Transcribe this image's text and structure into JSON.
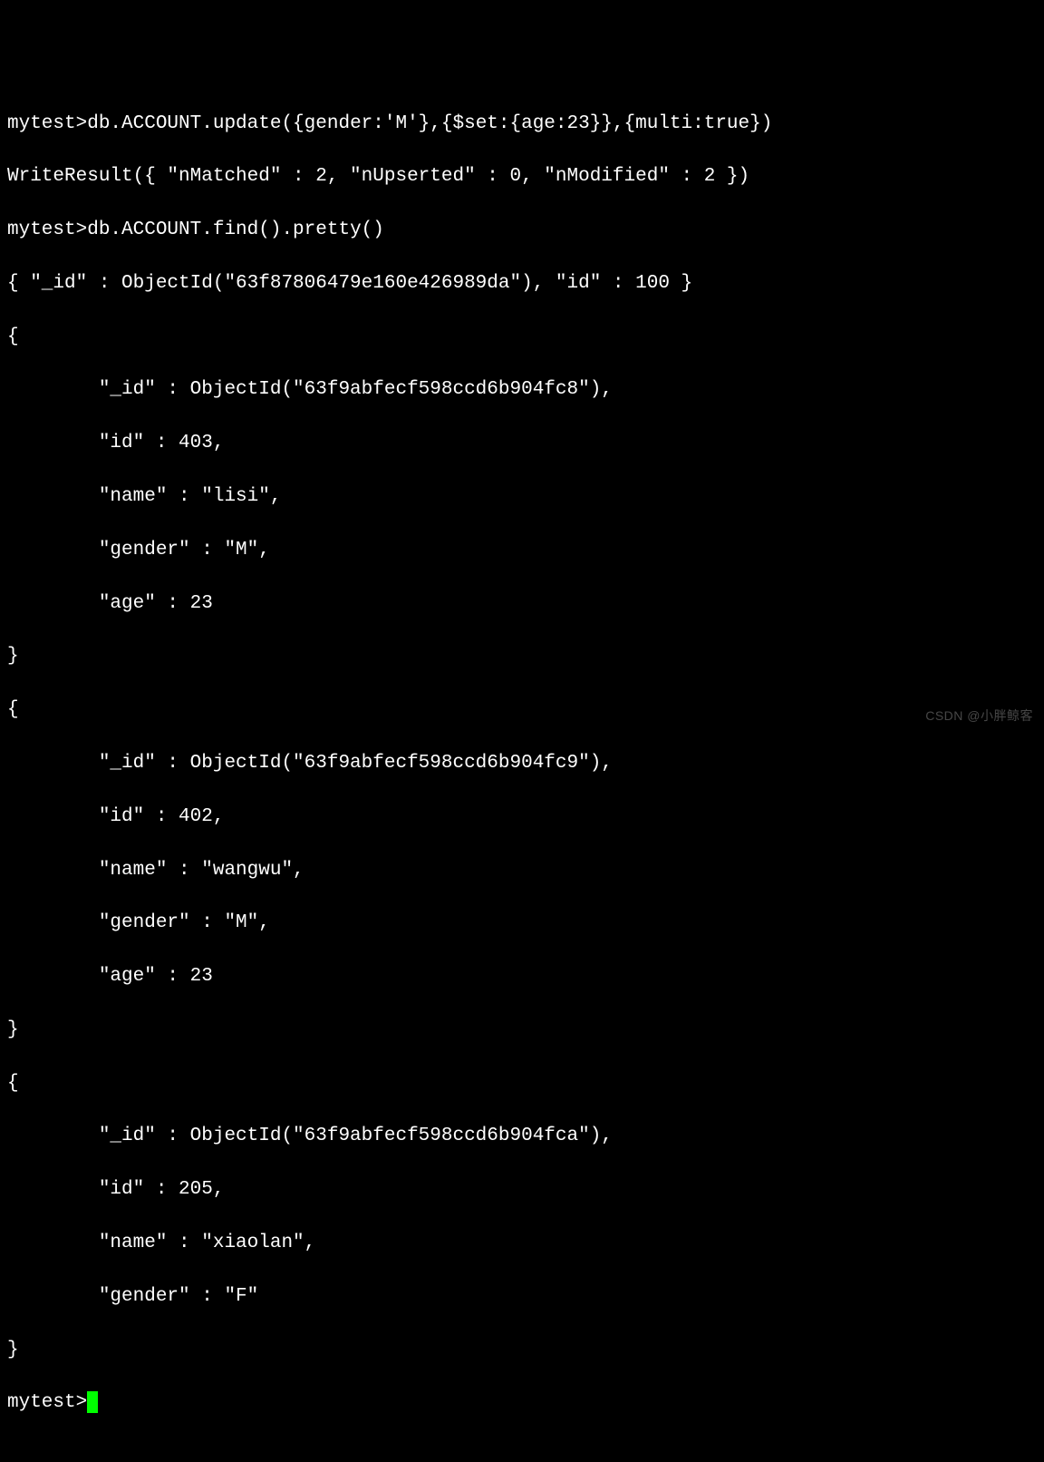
{
  "prompt": "mytest>",
  "cmd1": "db.ACCOUNT.update({gender:'M'},{$set:{age:23}},{multi:true})",
  "result1": "WriteResult({ \"nMatched\" : 2, \"nUpserted\" : 0, \"nModified\" : 2 })",
  "cmd2": "db.ACCOUNT.find().pretty()",
  "doc0": "{ \"_id\" : ObjectId(\"63f87806479e160e426989da\"), \"id\" : 100 }",
  "open": "{",
  "close": "}",
  "doc1": {
    "id_line": "        \"_id\" : ObjectId(\"63f9abfecf598ccd6b904fc8\"),",
    "num_line": "        \"id\" : 403,",
    "name_line": "        \"name\" : \"lisi\",",
    "gender_line": "        \"gender\" : \"M\",",
    "age_line": "        \"age\" : 23"
  },
  "doc2": {
    "id_line": "        \"_id\" : ObjectId(\"63f9abfecf598ccd6b904fc9\"),",
    "num_line": "        \"id\" : 402,",
    "name_line": "        \"name\" : \"wangwu\",",
    "gender_line": "        \"gender\" : \"M\",",
    "age_line": "        \"age\" : 23"
  },
  "doc3": {
    "id_line": "        \"_id\" : ObjectId(\"63f9abfecf598ccd6b904fca\"),",
    "num_line": "        \"id\" : 205,",
    "name_line": "        \"name\" : \"xiaolan\",",
    "gender_line": "        \"gender\" : \"F\""
  },
  "watermark": "CSDN @小胖鲸客"
}
